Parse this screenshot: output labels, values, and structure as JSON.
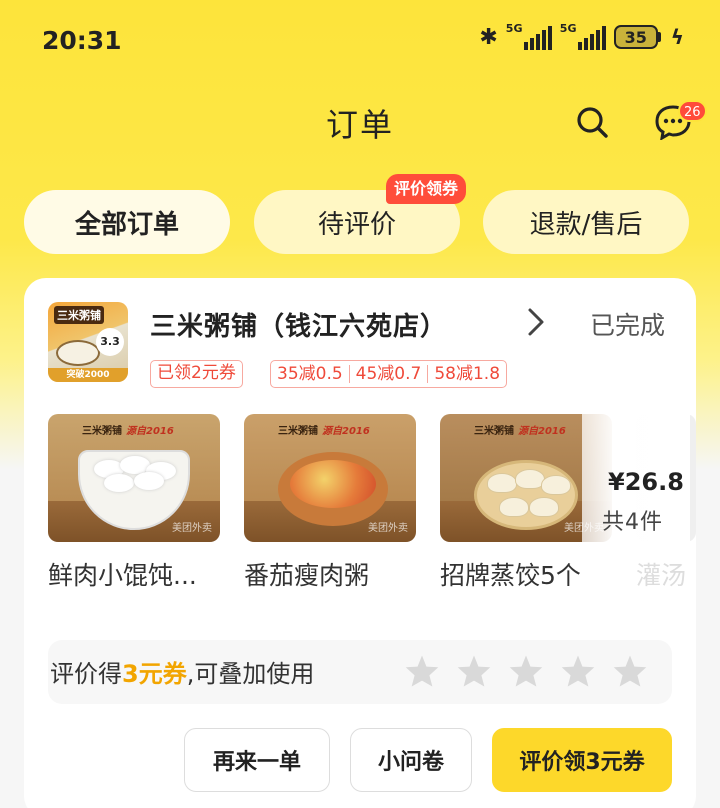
{
  "status_bar": {
    "time": "20:31",
    "network_1": "5G",
    "network_2": "5G",
    "battery": "35"
  },
  "header": {
    "title": "订单",
    "message_badge": "26"
  },
  "tabs": [
    {
      "label": "全部订单",
      "active": true
    },
    {
      "label": "待评价",
      "active": false,
      "promo": "评价领券"
    },
    {
      "label": "退款/售后",
      "active": false
    }
  ],
  "order": {
    "shop_logo": {
      "brand": "三米粥铺",
      "badge": "3.3",
      "footer": "突破2000"
    },
    "shop_name": "三米粥铺（钱江六苑店）",
    "status": "已完成",
    "coupon": "已领2元券",
    "discounts": [
      "35减0.5",
      "45减0.7",
      "58减1.8"
    ],
    "products": [
      {
        "name": "鲜肉小馄饨...",
        "image_brand": "三米粥铺",
        "image_slogan": "源自2016",
        "watermark": "美团外卖"
      },
      {
        "name": "番茄瘦肉粥",
        "image_brand": "三米粥铺",
        "image_slogan": "源自2016",
        "watermark": "美团外卖"
      },
      {
        "name": "招牌蒸饺5个",
        "image_brand": "三米粥铺",
        "image_slogan": "源自2016",
        "watermark": "美团外卖"
      },
      {
        "name": "灌汤"
      }
    ],
    "total_price": "¥26.8",
    "total_count": "共4件",
    "review": {
      "prefix": "评价得",
      "highlight": "3元券",
      "suffix": ",可叠加使用",
      "stars": 5
    },
    "buttons": {
      "reorder": "再来一单",
      "survey": "小问卷",
      "review": "评价领3元券"
    }
  },
  "colors": {
    "brand_yellow": "#fde43b",
    "badge_red": "#ff4b3a",
    "coupon_red": "#ef4a3a",
    "highlight_orange": "#f2a500",
    "primary_button": "#fdd82a"
  }
}
